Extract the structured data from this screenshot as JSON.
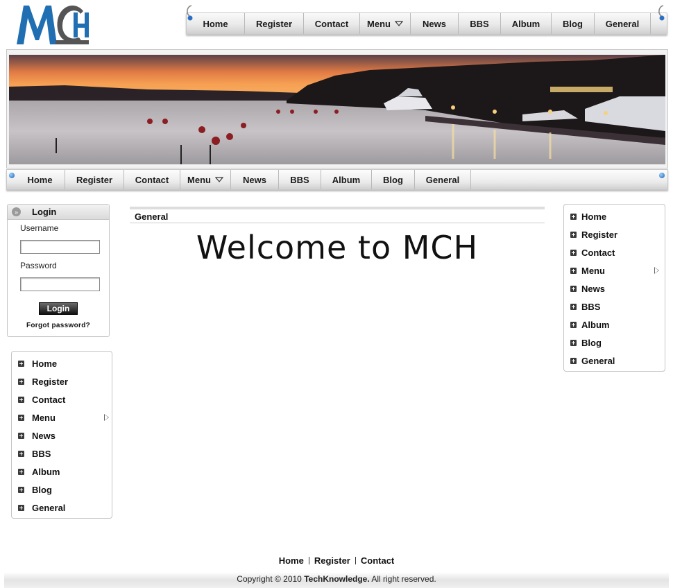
{
  "logo": {
    "text": "MCH",
    "colors": {
      "M": "#1f6fb2",
      "C": "#555555",
      "H": "#1f6fb2"
    }
  },
  "top_nav": {
    "items": [
      {
        "label": "Home"
      },
      {
        "label": "Register"
      },
      {
        "label": "Contact"
      },
      {
        "label": "Menu",
        "has_dropdown": true
      },
      {
        "label": "News"
      },
      {
        "label": "BBS"
      },
      {
        "label": "Album"
      },
      {
        "label": "Blog"
      },
      {
        "label": "General"
      }
    ]
  },
  "banner": {
    "description_colors": {
      "sky_top": "#4a3a3a",
      "sky_glow": "#f39a4a",
      "water": "#b8b3b4"
    }
  },
  "sec_nav": {
    "items": [
      {
        "label": "Home"
      },
      {
        "label": "Register"
      },
      {
        "label": "Contact"
      },
      {
        "label": "Menu",
        "has_dropdown": true
      },
      {
        "label": "News"
      },
      {
        "label": "BBS"
      },
      {
        "label": "Album"
      },
      {
        "label": "Blog"
      },
      {
        "label": "General"
      }
    ]
  },
  "login": {
    "title": "Login",
    "username_label": "Username",
    "username_value": "",
    "password_label": "Password",
    "password_value": "",
    "button_label": "Login",
    "forgot_label": "Forgot password?"
  },
  "left_menu": {
    "items": [
      {
        "label": "Home"
      },
      {
        "label": "Register"
      },
      {
        "label": "Contact"
      },
      {
        "label": "Menu",
        "has_submenu": true
      },
      {
        "label": "News"
      },
      {
        "label": "BBS"
      },
      {
        "label": "Album"
      },
      {
        "label": "Blog"
      },
      {
        "label": "General"
      }
    ]
  },
  "right_menu": {
    "items": [
      {
        "label": "Home"
      },
      {
        "label": "Register"
      },
      {
        "label": "Contact"
      },
      {
        "label": "Menu",
        "has_submenu": true
      },
      {
        "label": "News"
      },
      {
        "label": "BBS"
      },
      {
        "label": "Album"
      },
      {
        "label": "Blog"
      },
      {
        "label": "General"
      }
    ]
  },
  "content": {
    "section_title": "General",
    "heading": "Welcome to MCH"
  },
  "footer": {
    "links": [
      {
        "label": "Home"
      },
      {
        "label": "Register"
      },
      {
        "label": "Contact"
      }
    ],
    "copyright_prefix": "Copyright © 2010",
    "company": "TechKnowledge.",
    "copyright_suffix": "All right reserved."
  }
}
